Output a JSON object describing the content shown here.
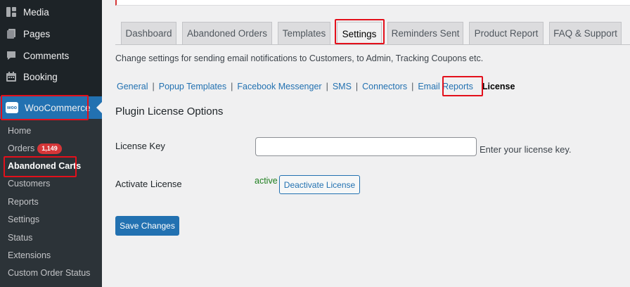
{
  "sidebar": {
    "menu": [
      {
        "label": "Media",
        "icon": "media-icon"
      },
      {
        "label": "Pages",
        "icon": "pages-icon"
      },
      {
        "label": "Comments",
        "icon": "comments-icon"
      },
      {
        "label": "Booking",
        "icon": "calendar-icon"
      }
    ],
    "woocommerce": {
      "label": "WooCommerce",
      "icon_text": "woo"
    },
    "submenu": {
      "home": "Home",
      "orders": "Orders",
      "orders_count": "1,149",
      "abandoned_carts": "Abandoned Carts",
      "customers": "Customers",
      "reports": "Reports",
      "settings": "Settings",
      "status": "Status",
      "extensions": "Extensions",
      "custom_order_status": "Custom Order Status"
    }
  },
  "tabs": [
    {
      "label": "Dashboard"
    },
    {
      "label": "Abandoned Orders"
    },
    {
      "label": "Templates"
    },
    {
      "label": "Settings"
    },
    {
      "label": "Reminders Sent"
    },
    {
      "label": "Product Report"
    },
    {
      "label": "FAQ & Support"
    }
  ],
  "description": "Change settings for sending email notifications to Customers, to Admin, Tracking Coupons etc.",
  "subnav": {
    "general": "General",
    "popup_templates": "Popup Templates",
    "facebook_messenger": "Facebook Messenger",
    "sms": "SMS",
    "connectors": "Connectors",
    "email_reports": "Email Reports",
    "license": "License",
    "separator": "|"
  },
  "section_title": "Plugin License Options",
  "license_key": {
    "label": "License Key",
    "value": "",
    "description": "Enter your license key."
  },
  "activate_license": {
    "label": "Activate License",
    "status": "active",
    "button": "Deactivate License"
  },
  "save_button": "Save Changes",
  "colors": {
    "sidebar": "#1d2327",
    "submenu": "#2c3338",
    "accent": "#2271b1",
    "highlight": "#e3101b",
    "badge": "#d63638",
    "status_active": "#1e7e1e"
  }
}
